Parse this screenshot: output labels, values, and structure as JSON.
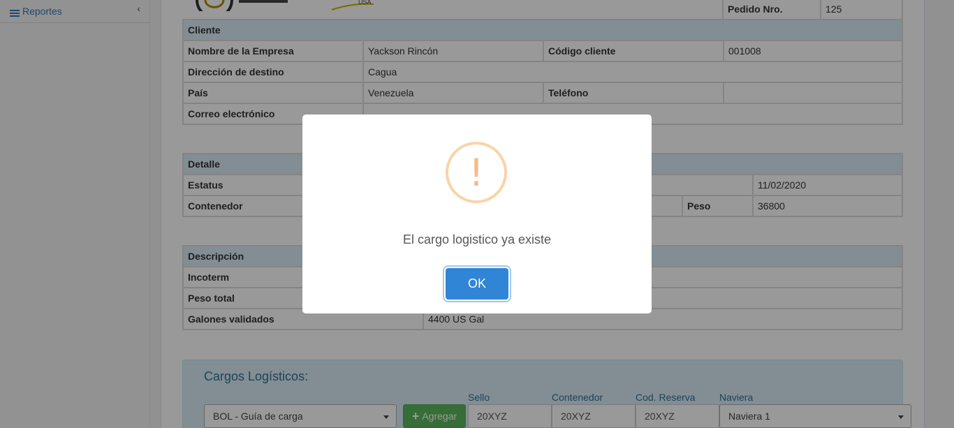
{
  "sidebar": {
    "item_label": "Reportes",
    "icon": "list-icon",
    "chevron": "‹"
  },
  "logo": {
    "text": "USA"
  },
  "pedido": {
    "label": "Pedido Nro.",
    "value": "125"
  },
  "cliente": {
    "header": "Cliente",
    "empresa_label": "Nombre de la Empresa",
    "empresa_value": "Yackson Rincón",
    "codigo_label": "Código cliente",
    "codigo_value": "001008",
    "direccion_label": "Dirección de destino",
    "direccion_value": "Cagua",
    "pais_label": "País",
    "pais_value": "Venezuela",
    "telefono_label": "Teléfono",
    "telefono_value": "",
    "correo_label": "Correo electrónico",
    "correo_value": ""
  },
  "detalle": {
    "header": "Detalle",
    "estatus_label": "Estatus",
    "fecha_value": "11/02/2020",
    "contenedor_label": "Contenedor",
    "peso_label": "Peso",
    "peso_value": "36800"
  },
  "descripcion": {
    "header": "Descripción",
    "incoterm_label": "Incoterm",
    "peso_total_label": "Peso total",
    "galones_label": "Galones validados",
    "galones_value": "4400 US Gal"
  },
  "cargos": {
    "title": "Cargos Logísticos:",
    "tipo_selected": "BOL - Guía de carga",
    "agregar_label": "Agregar",
    "sello_label": "Sello",
    "sello_value": "20XYZ",
    "contenedor_label": "Contenedor",
    "contenedor_value": "20XYZ",
    "reserva_label": "Cod. Reserva",
    "reserva_value": "20XYZ",
    "naviera_label": "Naviera",
    "naviera_selected": "Naviera 1"
  },
  "modal": {
    "icon": "!",
    "message": "El cargo logistico ya existe",
    "ok_label": "OK"
  },
  "colors": {
    "header_bg": "#d9edf7",
    "ok_button": "#3085d6",
    "warning": "#f8bb86",
    "agregar": "#5cb85c"
  }
}
